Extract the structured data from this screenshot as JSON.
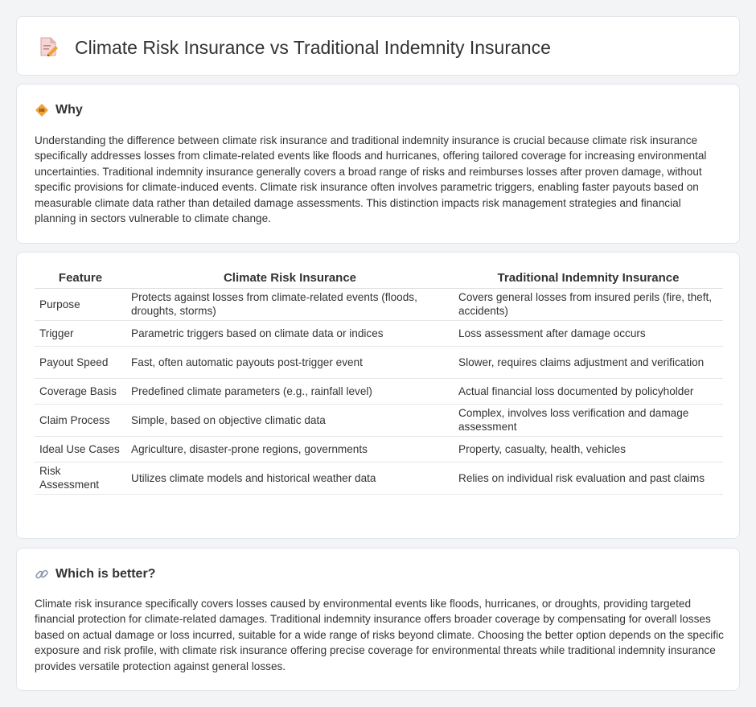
{
  "header": {
    "title": "Climate Risk Insurance vs Traditional Indemnity Insurance",
    "icon": "document-pencil-icon"
  },
  "why": {
    "title": "Why",
    "icon": "diamond-icon",
    "text": "Understanding the difference between climate risk insurance and traditional indemnity insurance is crucial because climate risk insurance specifically addresses losses from climate-related events like floods and hurricanes, offering tailored coverage for increasing environmental uncertainties. Traditional indemnity insurance generally covers a broad range of risks and reimburses losses after proven damage, without specific provisions for climate-induced events. Climate risk insurance often involves parametric triggers, enabling faster payouts based on measurable climate data rather than detailed damage assessments. This distinction impacts risk management strategies and financial planning in sectors vulnerable to climate change."
  },
  "table": {
    "headers": [
      "Feature",
      "Climate Risk Insurance",
      "Traditional Indemnity Insurance"
    ],
    "rows": [
      [
        "Purpose",
        "Protects against losses from climate-related events (floods, droughts, storms)",
        "Covers general losses from insured perils (fire, theft, accidents)"
      ],
      [
        "Trigger",
        "Parametric triggers based on climate data or indices",
        "Loss assessment after damage occurs"
      ],
      [
        "Payout Speed",
        "Fast, often automatic payouts post-trigger event",
        "Slower, requires claims adjustment and verification"
      ],
      [
        "Coverage Basis",
        "Predefined climate parameters (e.g., rainfall level)",
        "Actual financial loss documented by policyholder"
      ],
      [
        "Claim Process",
        "Simple, based on objective climatic data",
        "Complex, involves loss verification and damage assessment"
      ],
      [
        "Ideal Use Cases",
        "Agriculture, disaster-prone regions, governments",
        "Property, casualty, health, vehicles"
      ],
      [
        "Risk Assessment",
        "Utilizes climate models and historical weather data",
        "Relies on individual risk evaluation and past claims"
      ]
    ]
  },
  "better": {
    "title": "Which is better?",
    "icon": "link-icon",
    "text": "Climate risk insurance specifically covers losses caused by environmental events like floods, hurricanes, or droughts, providing targeted financial protection for climate-related damages. Traditional indemnity insurance offers broader coverage by compensating for overall losses based on actual damage or loss incurred, suitable for a wide range of risks beyond climate. Choosing the better option depends on the specific exposure and risk profile, with climate risk insurance offering precise coverage for environmental threats while traditional indemnity insurance provides versatile protection against general losses."
  },
  "colors": {
    "page_bg": "#f3f4f6",
    "card_bg": "#ffffff",
    "accent_orange": "#f0a23a"
  }
}
